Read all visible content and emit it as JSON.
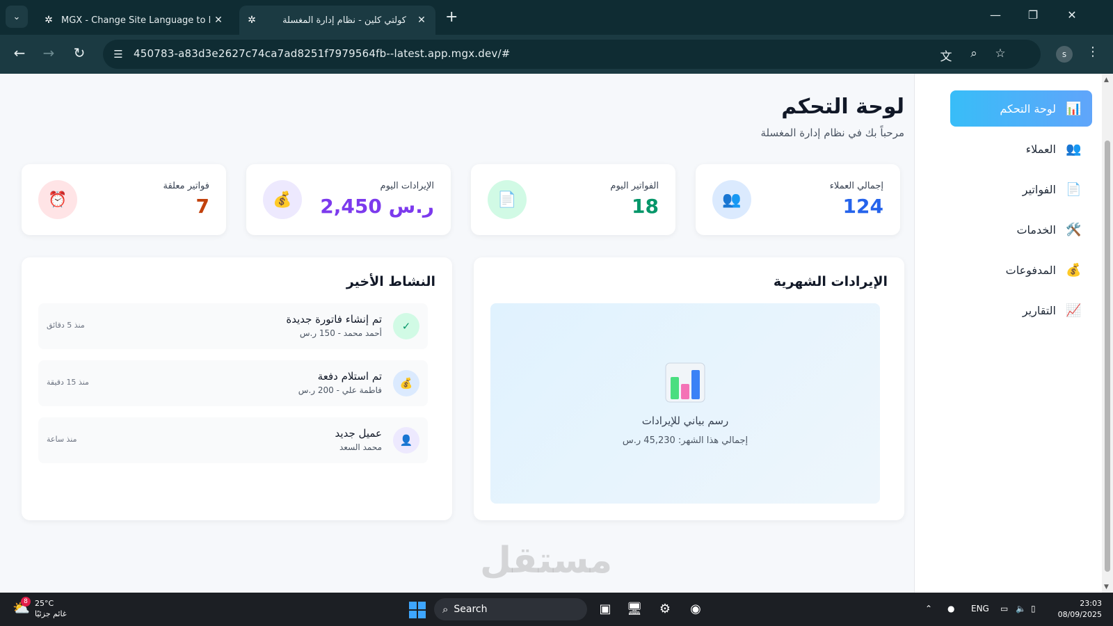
{
  "browser": {
    "tabs": [
      {
        "title": "MGX - Change Site Language to PHP",
        "active": false
      },
      {
        "title": "كولتي كلين - نظام إدارة المغسلة",
        "active": true
      }
    ],
    "url": "450783-a83d3e2627c74ca7ad8251f7979564fb--latest.app.mgx.dev/#",
    "profile_initial": "s"
  },
  "sidebar": {
    "items": [
      {
        "label": "لوحة التحكم",
        "icon": "bar-chart-icon",
        "glyph": "📊",
        "active": true
      },
      {
        "label": "العملاء",
        "icon": "users-icon",
        "glyph": "👥",
        "active": false
      },
      {
        "label": "الفواتير",
        "icon": "document-icon",
        "glyph": "📄",
        "active": false
      },
      {
        "label": "الخدمات",
        "icon": "tools-icon",
        "glyph": "🛠️",
        "active": false
      },
      {
        "label": "المدفوعات",
        "icon": "money-bag-icon",
        "glyph": "💰",
        "active": false
      },
      {
        "label": "التقارير",
        "icon": "trend-chart-icon",
        "glyph": "📈",
        "active": false
      }
    ]
  },
  "header": {
    "title": "لوحة التحكم",
    "subtitle": "مرحباً بك في نظام إدارة المغسلة"
  },
  "stats": [
    {
      "label": "إجمالي العملاء",
      "value": "124",
      "icon": "users-icon",
      "glyph": "👥",
      "color": "#2563eb",
      "bg": "#dbeafe"
    },
    {
      "label": "الفواتير اليوم",
      "value": "18",
      "icon": "document-icon",
      "glyph": "📄",
      "color": "#059669",
      "bg": "#d1fae5"
    },
    {
      "label": "الإيرادات اليوم",
      "value": "2,450 ر.س",
      "icon": "money-bag-icon",
      "glyph": "💰",
      "color": "#7c3aed",
      "bg": "#ede9fe"
    },
    {
      "label": "فواتير معلقة",
      "value": "7",
      "icon": "alarm-clock-icon",
      "glyph": "⏰",
      "color": "#c2410c",
      "bg": "#ffe4e6"
    }
  ],
  "revenue_panel": {
    "title": "الإيرادات الشهرية",
    "chart_label": "رسم بياني للإيرادات",
    "total_text": "إجمالي هذا الشهر: 45,230 ر.س"
  },
  "activity_panel": {
    "title": "النشاط الأخير",
    "items": [
      {
        "title": "تم إنشاء فاتورة جديدة",
        "detail": "أحمد محمد - 150 ر.س",
        "time": "منذ 5 دقائق",
        "icon": "check-icon",
        "glyph": "✓",
        "bg": "#d1fae5",
        "color": "#059669"
      },
      {
        "title": "تم استلام دفعة",
        "detail": "فاطمة علي - 200 ر.س",
        "time": "منذ 15 دقيقة",
        "icon": "money-bag-icon",
        "glyph": "💰",
        "bg": "#dbeafe",
        "color": "#2563eb"
      },
      {
        "title": "عميل جديد",
        "detail": "محمد السعد",
        "time": "منذ ساعة",
        "icon": "user-icon",
        "glyph": "👤",
        "bg": "#ede9fe",
        "color": "#7c3aed"
      }
    ]
  },
  "watermark": "مستقل",
  "taskbar": {
    "weather_temp": "25°C",
    "weather_desc": "غائم جزئيًا",
    "weather_badge": "8",
    "search_label": "Search",
    "language": "ENG",
    "time": "23:03",
    "date": "08/09/2025"
  }
}
